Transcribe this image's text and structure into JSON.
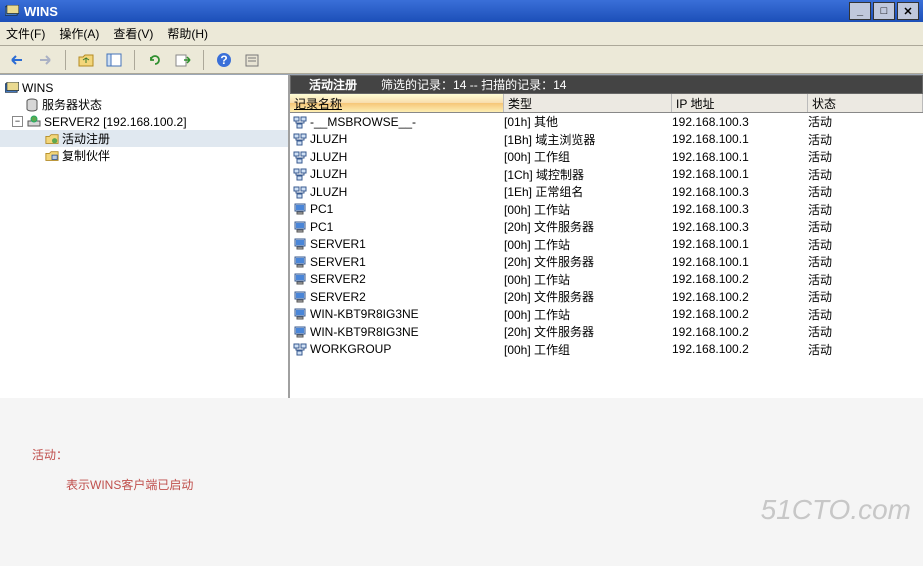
{
  "window": {
    "title": "WINS"
  },
  "menu": {
    "file": "文件(F)",
    "action": "操作(A)",
    "view": "查看(V)",
    "help": "帮助(H)"
  },
  "tree": {
    "root": "WINS",
    "server_status": "服务器状态",
    "server_node": "SERVER2 [192.168.100.2]",
    "active_reg": "活动注册",
    "rep_partner": "复制伙伴"
  },
  "list_header": {
    "title": "活动注册",
    "filter_label": "筛选的记录：",
    "filter_count": "14",
    "sep": " -- ",
    "scan_label": "扫描的记录：",
    "scan_count": "14"
  },
  "columns": {
    "name": "记录名称",
    "type": "类型",
    "ip": "IP 地址",
    "state": "状态"
  },
  "records": [
    {
      "icon": "net",
      "name": "-__MSBROWSE__-",
      "type": "[01h] 其他",
      "ip": "192.168.100.3",
      "state": "活动"
    },
    {
      "icon": "net",
      "name": "JLUZH",
      "type": "[1Bh] 域主浏览器",
      "ip": "192.168.100.1",
      "state": "活动"
    },
    {
      "icon": "net",
      "name": "JLUZH",
      "type": "[00h] 工作组",
      "ip": "192.168.100.1",
      "state": "活动"
    },
    {
      "icon": "net",
      "name": "JLUZH",
      "type": "[1Ch] 域控制器",
      "ip": "192.168.100.1",
      "state": "活动"
    },
    {
      "icon": "net",
      "name": "JLUZH",
      "type": "[1Eh] 正常组名",
      "ip": "192.168.100.3",
      "state": "活动"
    },
    {
      "icon": "pc",
      "name": "PC1",
      "type": "[00h] 工作站",
      "ip": "192.168.100.3",
      "state": "活动"
    },
    {
      "icon": "pc",
      "name": "PC1",
      "type": "[20h] 文件服务器",
      "ip": "192.168.100.3",
      "state": "活动"
    },
    {
      "icon": "pc",
      "name": "SERVER1",
      "type": "[00h] 工作站",
      "ip": "192.168.100.1",
      "state": "活动"
    },
    {
      "icon": "pc",
      "name": "SERVER1",
      "type": "[20h] 文件服务器",
      "ip": "192.168.100.1",
      "state": "活动"
    },
    {
      "icon": "pc",
      "name": "SERVER2",
      "type": "[00h] 工作站",
      "ip": "192.168.100.2",
      "state": "活动"
    },
    {
      "icon": "pc",
      "name": "SERVER2",
      "type": "[20h] 文件服务器",
      "ip": "192.168.100.2",
      "state": "活动"
    },
    {
      "icon": "pc",
      "name": "WIN-KBT9R8IG3NE",
      "type": "[00h] 工作站",
      "ip": "192.168.100.2",
      "state": "活动"
    },
    {
      "icon": "pc",
      "name": "WIN-KBT9R8IG3NE",
      "type": "[20h] 文件服务器",
      "ip": "192.168.100.2",
      "state": "活动"
    },
    {
      "icon": "net",
      "name": "WORKGROUP",
      "type": "[00h] 工作组",
      "ip": "192.168.100.2",
      "state": "活动"
    }
  ],
  "annotation": {
    "line1": "活动：",
    "line2": "表示WINS客户端已启动"
  },
  "watermark": "51CTO.com"
}
